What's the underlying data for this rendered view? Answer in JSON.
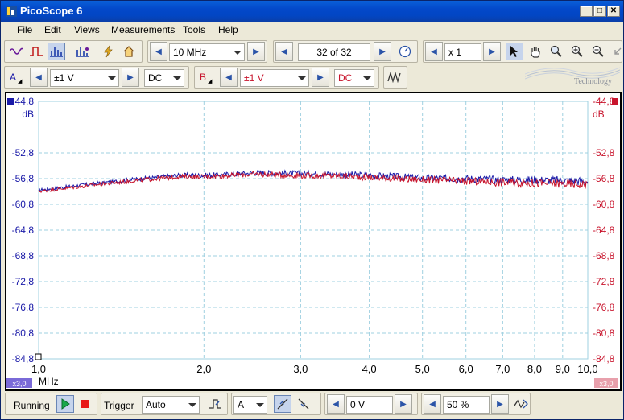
{
  "window": {
    "title": "PicoScope 6"
  },
  "menu": {
    "items": [
      "File",
      "Edit",
      "Views",
      "Measurements",
      "Tools",
      "Help"
    ]
  },
  "toolbar": {
    "bandwidth": "10 MHz",
    "buffer": "32 of 32",
    "zoom": "x 1"
  },
  "channels": {
    "a": {
      "label": "A",
      "range": "±1 V",
      "coupling": "DC",
      "color": "#1a1aa8"
    },
    "b": {
      "label": "B",
      "range": "±1 V",
      "coupling": "DC",
      "color": "#c8142c"
    }
  },
  "logo_text": "Technology",
  "plot": {
    "y_unit": "dB",
    "x_unit": "MHz",
    "scale_left": "x3,0",
    "scale_right": "x3,0",
    "y_ticks": [
      "-44,8",
      "-52,8",
      "-56,8",
      "-60,8",
      "-64,8",
      "-68,8",
      "-72,8",
      "-76,8",
      "-80,8",
      "-84,8"
    ],
    "x_ticks": [
      "1,0",
      "2,0",
      "3,0",
      "4,0",
      "5,0",
      "6,0",
      "7,0",
      "8,0",
      "9,0",
      "10,0"
    ]
  },
  "chart_data": {
    "type": "line",
    "x_scale": "log",
    "xlim": [
      1.0,
      10.0
    ],
    "ylim": [
      -84.8,
      -44.8
    ],
    "xlabel": "MHz",
    "ylabel": "dB",
    "series": [
      {
        "name": "A",
        "color": "#1a1aa8",
        "x": [
          1.0,
          1.2,
          1.5,
          1.8,
          2.0,
          2.5,
          3.0,
          3.5,
          4.0,
          5.0,
          6.0,
          7.0,
          8.0,
          9.0,
          10.0
        ],
        "y": [
          -58.6,
          -57.8,
          -56.9,
          -56.3,
          -56.3,
          -55.9,
          -56.0,
          -56.1,
          -56.3,
          -56.7,
          -56.8,
          -57.0,
          -57.0,
          -57.1,
          -57.2
        ]
      },
      {
        "name": "B",
        "color": "#c8142c",
        "x": [
          1.0,
          1.2,
          1.5,
          1.8,
          2.0,
          2.5,
          3.0,
          3.5,
          4.0,
          5.0,
          6.0,
          7.0,
          8.0,
          9.0,
          10.0
        ],
        "y": [
          -58.8,
          -58.0,
          -57.1,
          -56.5,
          -56.5,
          -56.1,
          -56.3,
          -56.4,
          -56.6,
          -57.0,
          -57.2,
          -57.4,
          -57.5,
          -57.6,
          -57.7
        ]
      }
    ]
  },
  "status": {
    "state": "Running",
    "trigger_label": "Trigger",
    "trigger_mode": "Auto",
    "trigger_source": "A",
    "threshold": "0 V",
    "pretrigger": "50 %"
  }
}
